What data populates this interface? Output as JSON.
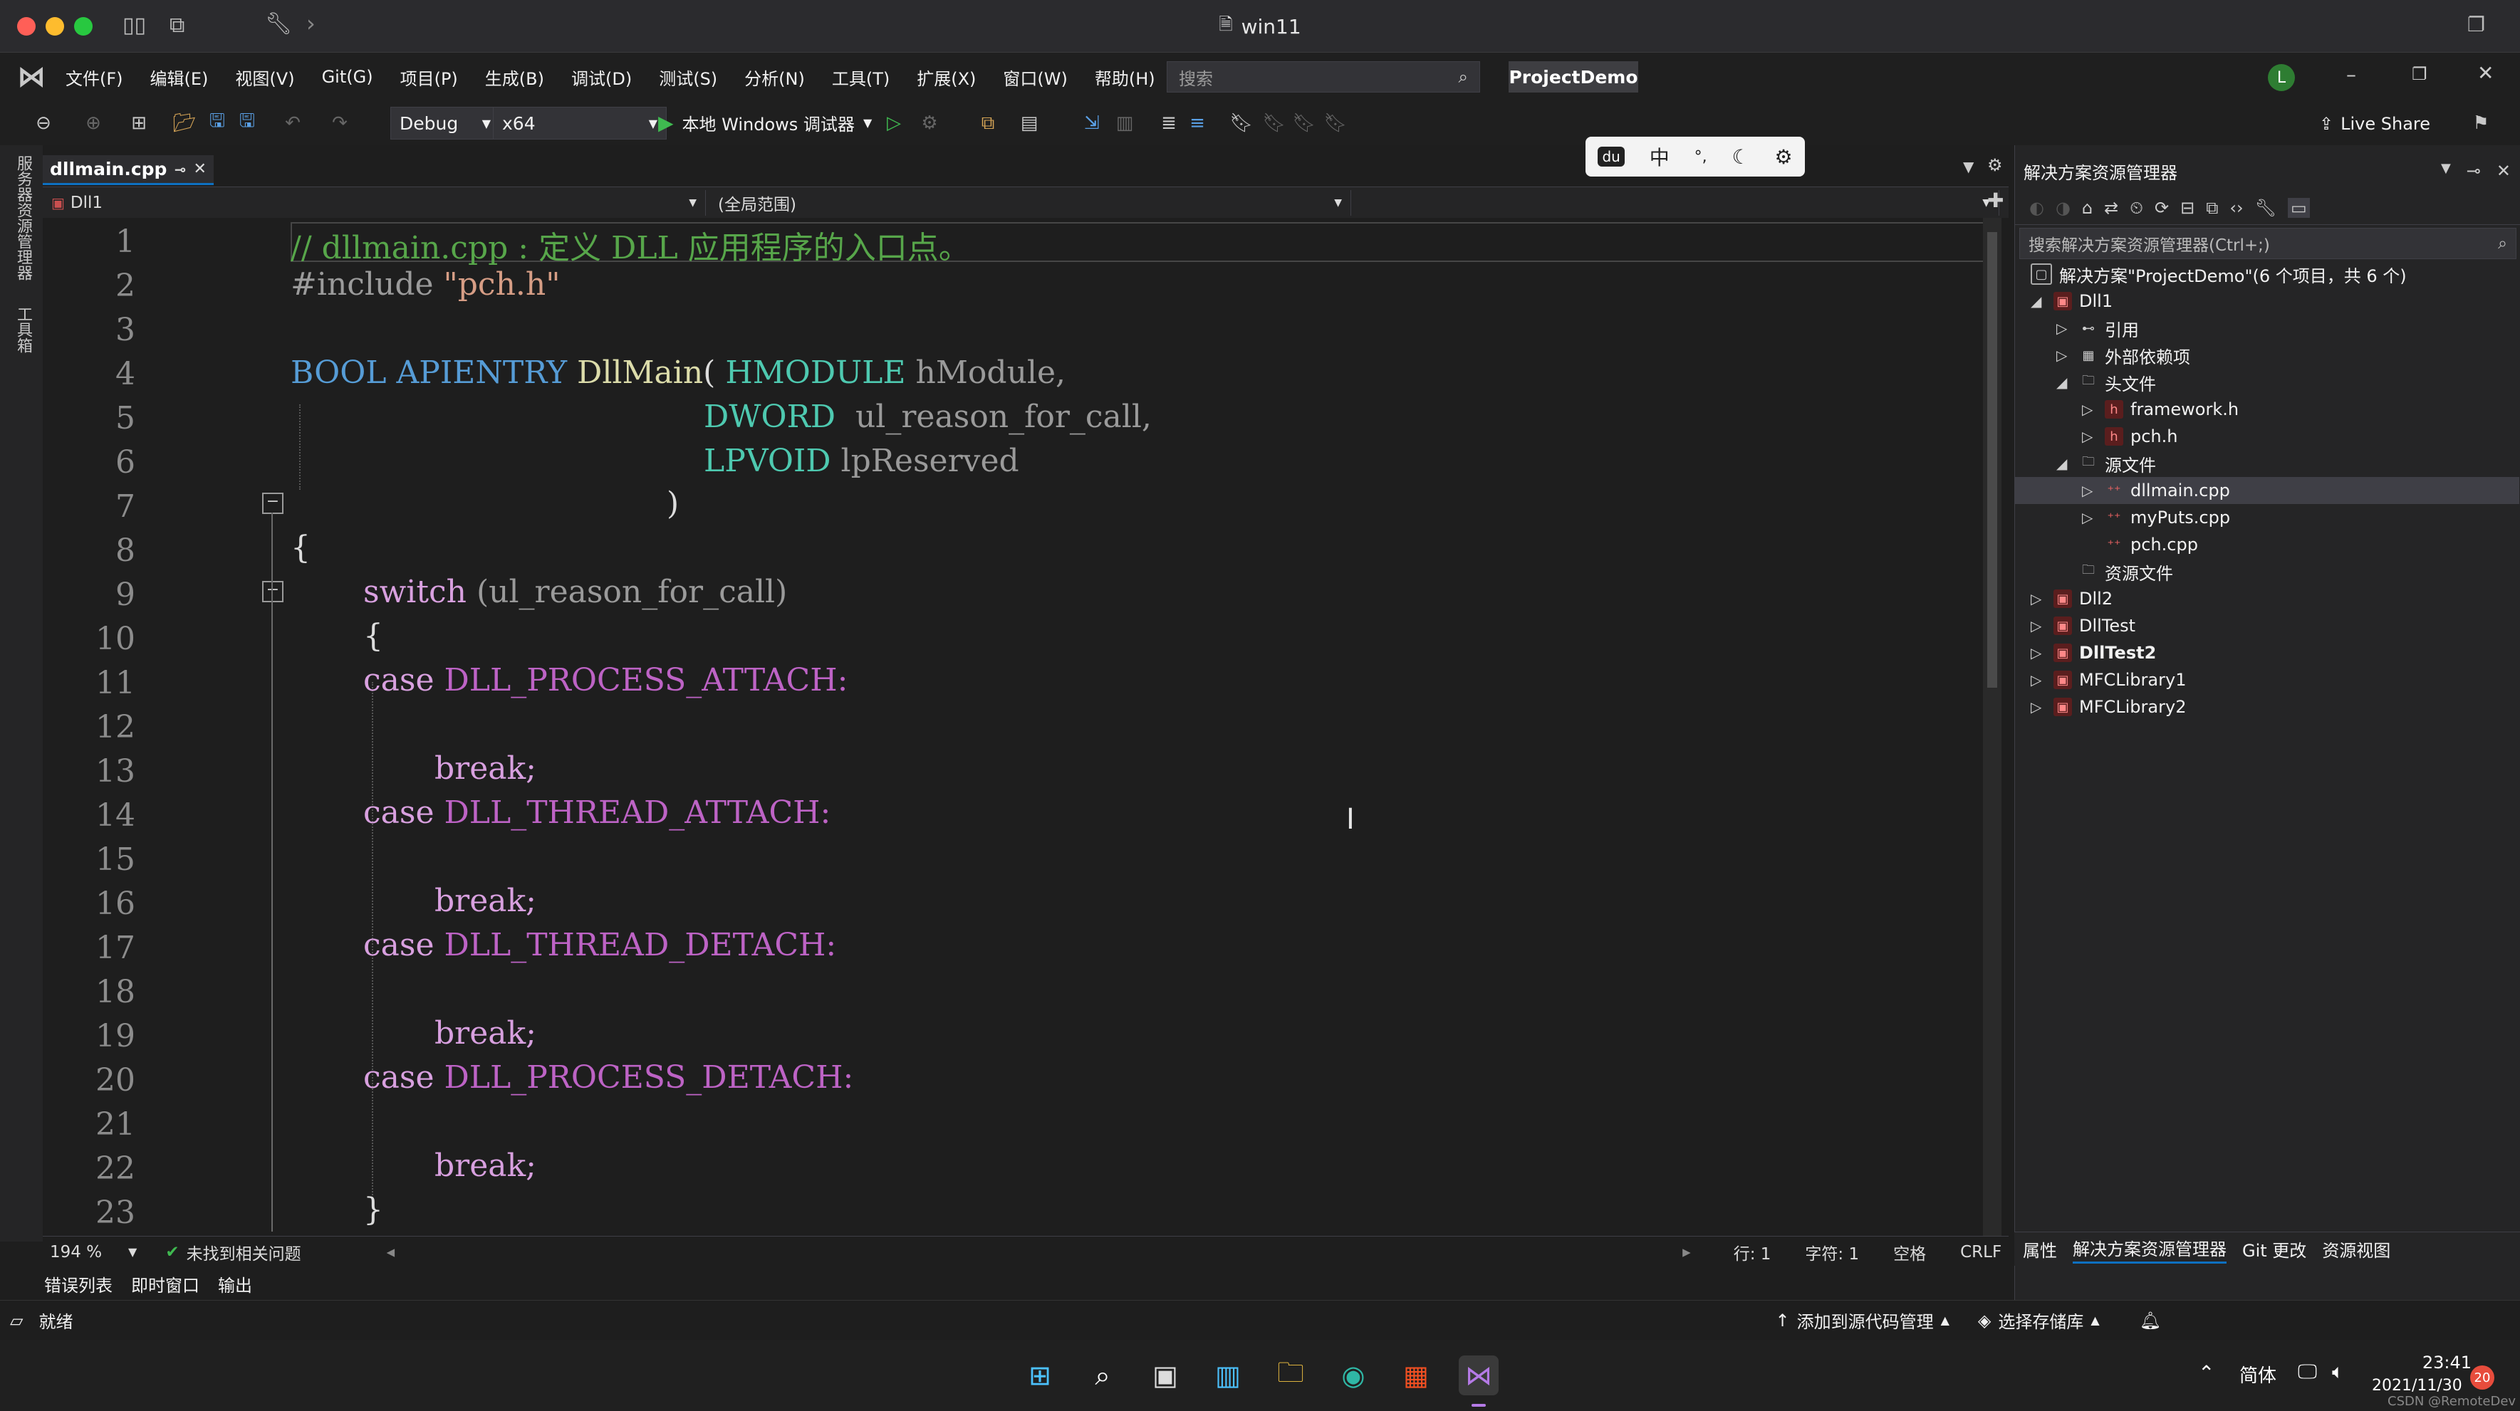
{
  "window": {
    "title": "win11"
  },
  "menu": {
    "items": [
      "文件(F)",
      "编辑(E)",
      "视图(V)",
      "Git(G)",
      "项目(P)",
      "生成(B)",
      "调试(D)",
      "测试(S)",
      "分析(N)",
      "工具(T)",
      "扩展(X)",
      "窗口(W)",
      "帮助(H)"
    ],
    "search_placeholder": "搜索",
    "project": "ProjectDemo",
    "avatar": "L"
  },
  "toolbar": {
    "config": "Debug",
    "platform": "x64",
    "run_label": "本地 Windows 调试器",
    "live_share": "Live Share"
  },
  "leftstrip": {
    "server_explorer": "服务器资源管理器",
    "toolbox": "工具箱"
  },
  "tab": {
    "name": "dllmain.cpp"
  },
  "nav": {
    "project": "Dll1",
    "scope": "(全局范围)",
    "member": ""
  },
  "ime": {
    "mode": "中",
    "punct": "°,"
  },
  "code": {
    "line_numbers": [
      "1",
      "2",
      "3",
      "4",
      "5",
      "6",
      "7",
      "8",
      "9",
      "10",
      "11",
      "12",
      "13",
      "14",
      "15",
      "16",
      "17",
      "18",
      "19",
      "20",
      "21",
      "22",
      "23"
    ],
    "l1": "// dllmain.cpp : 定义 DLL 应用程序的入口点。",
    "l2a": "#include ",
    "l2b": "\"pch.h\"",
    "l4a": "BOOL APIENTRY ",
    "l4b": "DllMain",
    "l4c": "( ",
    "l4d": "HMODULE",
    "l4e": " hModule,",
    "l5a": "DWORD",
    "l5b": "  ul_reason_for_call,",
    "l6a": "LPVOID",
    "l6b": " lpReserved",
    "l7": ")",
    "l8": "{",
    "l9a": "switch",
    "l9b": " (ul_reason_for_call)",
    "l10": "{",
    "l11a": "case ",
    "l11b": "DLL_PROCESS_ATTACH:",
    "l13": "break;",
    "l14a": "case ",
    "l14b": "DLL_THREAD_ATTACH:",
    "l16": "break;",
    "l17a": "case ",
    "l17b": "DLL_THREAD_DETACH:",
    "l19": "break;",
    "l20a": "case ",
    "l20b": "DLL_PROCESS_DETACH:",
    "l22": "break;",
    "l23": "}"
  },
  "editor_status": {
    "zoom": "194 %",
    "issues": "未找到相关问题",
    "line": "行: 1",
    "char": "字符: 1",
    "indent": "空格",
    "eol": "CRLF"
  },
  "output_tabs": [
    "错误列表",
    "即时窗口",
    "输出"
  ],
  "solution_explorer": {
    "title": "解决方案资源管理器",
    "search_placeholder": "搜索解决方案资源管理器(Ctrl+;)",
    "solution": "解决方案\"ProjectDemo\"(6 个项目，共 6 个)",
    "nodes": {
      "dll1": "Dll1",
      "refs": "引用",
      "extdeps": "外部依赖项",
      "headers": "头文件",
      "framework": "framework.h",
      "pch_h": "pch.h",
      "sources": "源文件",
      "dllmain": "dllmain.cpp",
      "myputs": "myPuts.cpp",
      "pch_cpp": "pch.cpp",
      "resources": "资源文件",
      "dll2": "Dll2",
      "dlltest": "DllTest",
      "dlltest2": "DllTest2",
      "mfc1": "MFCLibrary1",
      "mfc2": "MFCLibrary2"
    },
    "bottom_tabs": [
      "属性",
      "解决方案资源管理器",
      "Git 更改",
      "资源视图"
    ]
  },
  "status": {
    "ready": "就绪",
    "add_source": "添加到源代码管理",
    "select_repo": "选择存储库"
  },
  "taskbar": {
    "lang": "简体",
    "time": "23:41",
    "date": "2021/11/30",
    "badge": "20",
    "watermark": "CSDN @RemoteDev"
  },
  "colors": {
    "keyword": "#569cd6",
    "comment": "#57a64a",
    "string": "#d69d85",
    "type": "#4ec9b0",
    "function": "#dcdcaa",
    "param": "#9a9a9a",
    "control": "#d8a0df",
    "macro": "#bd63c5",
    "accent": "#0e70c0"
  }
}
